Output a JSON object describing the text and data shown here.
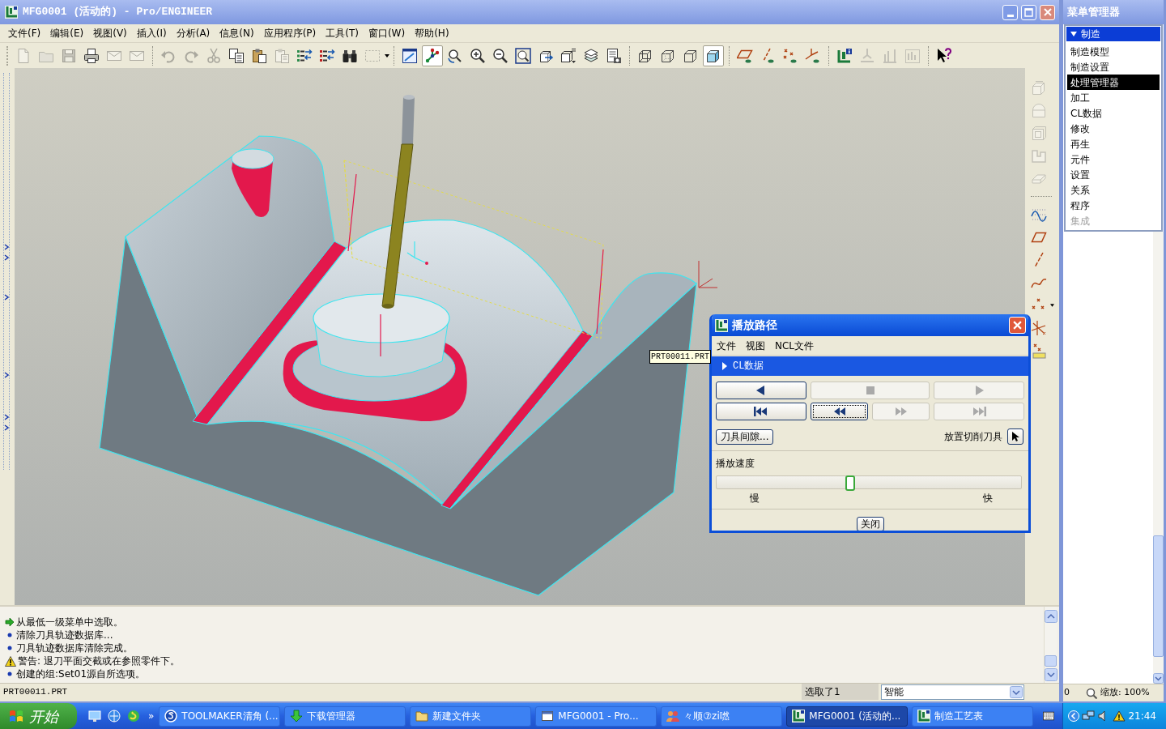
{
  "window": {
    "title": "MFG0001 (活动的) - Pro/ENGINEER"
  },
  "menu_bar": [
    "文件(F)",
    "编辑(E)",
    "视图(V)",
    "插入(I)",
    "分析(A)",
    "信息(N)",
    "应用程序(P)",
    "工具(T)",
    "窗口(W)",
    "帮助(H)"
  ],
  "toolbar": [
    [
      {
        "disabled": true,
        "on": false
      },
      {
        "disabled": true,
        "on": false
      },
      {
        "disabled": true,
        "on": false
      },
      {
        "disabled": false,
        "on": false
      },
      {
        "disabled": true,
        "on": false
      },
      {
        "disabled": true,
        "on": false
      }
    ],
    [
      {
        "disabled": true,
        "on": false
      },
      {
        "disabled": true,
        "on": false
      },
      {
        "disabled": true,
        "on": false
      },
      {
        "disabled": false,
        "on": false
      },
      {
        "disabled": false,
        "on": false
      },
      {
        "disabled": true,
        "on": false
      },
      {
        "disabled": false,
        "on": false
      },
      {
        "disabled": false,
        "on": false
      },
      {
        "disabled": false,
        "on": false
      },
      {
        "disabled": true,
        "on": false
      }
    ],
    [
      {
        "disabled": false,
        "on": false
      },
      {
        "disabled": false,
        "on": true
      },
      {
        "disabled": false,
        "on": false
      },
      {
        "disabled": false,
        "on": false
      },
      {
        "disabled": false,
        "on": false
      },
      {
        "disabled": false,
        "on": false
      },
      {
        "disabled": false,
        "on": false
      },
      {
        "disabled": false,
        "on": false
      },
      {
        "disabled": false,
        "on": false
      },
      {
        "disabled": false,
        "on": false
      }
    ],
    [
      {
        "disabled": false,
        "on": false
      },
      {
        "disabled": false,
        "on": false
      },
      {
        "disabled": false,
        "on": false
      },
      {
        "disabled": false,
        "on": true
      }
    ],
    [
      {
        "disabled": false,
        "on": false
      },
      {
        "disabled": false,
        "on": false
      },
      {
        "disabled": false,
        "on": false
      },
      {
        "disabled": false,
        "on": false
      }
    ],
    [
      {
        "disabled": false,
        "on": false
      },
      {
        "disabled": true,
        "on": false
      },
      {
        "disabled": true,
        "on": false
      },
      {
        "disabled": true,
        "on": false
      }
    ],
    [
      {
        "disabled": false,
        "on": false
      }
    ]
  ],
  "side_toolbar": [
    [
      {
        "disabled": true
      },
      {
        "disabled": true
      },
      {
        "disabled": true
      },
      {
        "disabled": true
      },
      {
        "disabled": true
      }
    ],
    [
      {
        "disabled": false
      },
      {
        "disabled": false
      },
      {
        "disabled": false
      },
      {
        "disabled": false
      },
      {
        "disabled": false
      },
      {
        "disabled": false
      },
      {
        "disabled": false
      }
    ]
  ],
  "viewport": {
    "tooltip": "PRT00011.PRT"
  },
  "messages": [
    {
      "kind": "prompt",
      "text": "从最低一级菜单中选取。"
    },
    {
      "kind": "info",
      "text": "清除刀具轨迹数据库..."
    },
    {
      "kind": "info",
      "text": "刀具轨迹数据库清除完成。"
    },
    {
      "kind": "warning",
      "text": "警告: 退刀平面交截或在参照零件下。"
    },
    {
      "kind": "info",
      "text": "创建的组:Set01源自所选项。"
    }
  ],
  "status_bar": {
    "file": "PRT00011.PRT",
    "selection": "选取了1",
    "filter": "智能"
  },
  "dialog": {
    "title": "播放路径",
    "menu": [
      "文件",
      "视图",
      "NCL文件"
    ],
    "section": {
      "label": "CL数据",
      "expanded": false
    },
    "transport": [
      [
        {
          "kind": "reverse",
          "disabled": false,
          "focused": false
        },
        {
          "kind": "stop",
          "disabled": true,
          "focused": false
        },
        {
          "kind": "play",
          "disabled": true,
          "focused": false
        }
      ],
      [
        {
          "kind": "to_start",
          "disabled": false,
          "focused": false
        },
        {
          "kind": "step_back",
          "disabled": false,
          "focused": true
        },
        {
          "kind": "step_forward",
          "disabled": true,
          "focused": false
        },
        {
          "kind": "to_end",
          "disabled": true,
          "focused": false
        }
      ]
    ],
    "clearance_button": "刀具间隙...",
    "place_tool_label": "放置切削刀具",
    "speed": {
      "label": "播放速度",
      "level": 0.44,
      "min_label": "慢",
      "max_label": "快"
    },
    "close_button": "关闭"
  },
  "menu_manager": {
    "title": "菜单管理器",
    "header": {
      "label": "制造",
      "expanded": true
    },
    "items": [
      {
        "label": "制造模型",
        "selected": false,
        "disabled": false
      },
      {
        "label": "制造设置",
        "selected": false,
        "disabled": false
      },
      {
        "label": "处理管理器",
        "selected": true,
        "disabled": false
      },
      {
        "label": "加工",
        "selected": false,
        "disabled": false
      },
      {
        "label": "CL数据",
        "selected": false,
        "disabled": false
      },
      {
        "label": "修改",
        "selected": false,
        "disabled": false
      },
      {
        "label": "再生",
        "selected": false,
        "disabled": false
      },
      {
        "label": "元件",
        "selected": false,
        "disabled": false
      },
      {
        "label": "设置",
        "selected": false,
        "disabled": false
      },
      {
        "label": "关系",
        "selected": false,
        "disabled": false
      },
      {
        "label": "程序",
        "selected": false,
        "disabled": false
      },
      {
        "label": "集成",
        "selected": false,
        "disabled": true
      }
    ],
    "status": "0",
    "zoom": "缩放: 100%"
  },
  "taskbar": {
    "start": "开始",
    "more": "»",
    "tasks": [
      {
        "label": "TOOLMAKER清角 (...",
        "active": false
      },
      {
        "label": "下载管理器",
        "active": false
      },
      {
        "label": "新建文件夹",
        "active": false
      },
      {
        "label": "MFG0001 - Pro...",
        "active": false
      },
      {
        "label": "々顺⑦zi嘫",
        "active": false
      },
      {
        "label": "MFG0001 (活动的...",
        "active": true
      },
      {
        "label": "制造工艺表",
        "active": false
      }
    ],
    "clock": "21:44"
  }
}
